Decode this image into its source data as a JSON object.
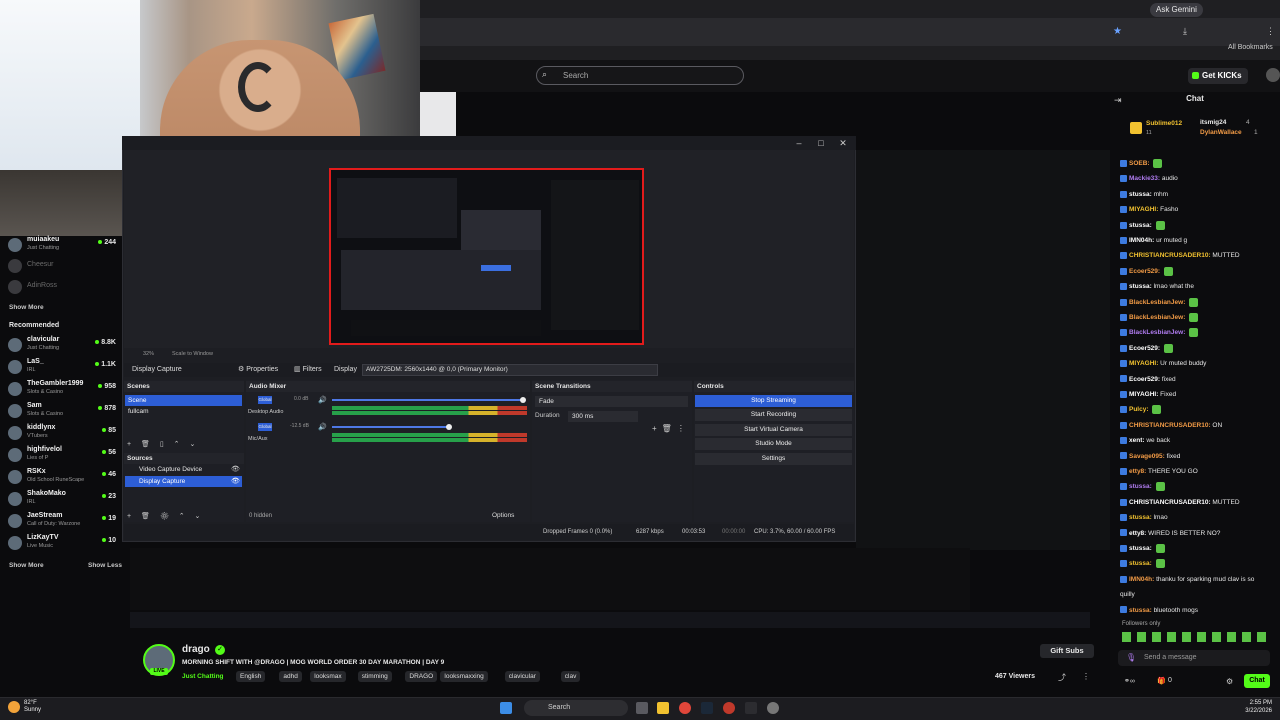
{
  "browser": {
    "ask_gemini": "Ask Gemini",
    "all_bookmarks": "All Bookmarks"
  },
  "kick_header": {
    "search_placeholder": "Search",
    "get_kicks": "Get KICKs"
  },
  "sidebar": {
    "top_items": [
      {
        "name": "muiaakeu",
        "category": "Just Chatting",
        "count": "244"
      },
      {
        "name": "Cheesur",
        "category": "",
        "count": ""
      },
      {
        "name": "AdinRoss",
        "category": "",
        "count": ""
      }
    ],
    "show_more_1": "Show More",
    "recommended_label": "Recommended",
    "recommended": [
      {
        "name": "clavicular",
        "category": "Just Chatting",
        "count": "8.8K"
      },
      {
        "name": "LaS_",
        "category": "IRL",
        "count": "1.1K"
      },
      {
        "name": "TheGambler1999",
        "category": "Slots & Casino",
        "count": "958"
      },
      {
        "name": "Sam",
        "category": "Slots & Casino",
        "count": "878"
      },
      {
        "name": "kiddlynx",
        "category": "VTubers",
        "count": "85"
      },
      {
        "name": "highfivelol",
        "category": "Lies of P",
        "count": "56"
      },
      {
        "name": "RSKx",
        "category": "Old School RuneScape",
        "count": "46"
      },
      {
        "name": "ShakoMako",
        "category": "IRL",
        "count": "23"
      },
      {
        "name": "JaeStream",
        "category": "Call of Duty: Warzone",
        "count": "19"
      },
      {
        "name": "LizKayTV",
        "category": "Live Music",
        "count": "10"
      }
    ],
    "show_more_2": "Show More",
    "show_less": "Show Less"
  },
  "obs": {
    "zoom": "32%",
    "scale_label": "Scale to Window",
    "source_name": "Display Capture",
    "properties": "Properties",
    "filters": "Filters",
    "display_label": "Display",
    "display_value": "AW2725DM: 2560x1440 @ 0,0 (Primary Monitor)",
    "scenes_header": "Scenes",
    "scenes": [
      "Scene",
      "fullcam"
    ],
    "sources_header": "Sources",
    "sources": [
      "Video Capture Device",
      "Display Capture"
    ],
    "mixer_header": "Audio Mixer",
    "channels": [
      {
        "badge": "Global",
        "name": "Desktop Audio",
        "db": "0.0 dB",
        "level": 0.98
      },
      {
        "badge": "Global",
        "name": "Mic/Aux",
        "db": "-12.5 dB",
        "level": 0.6
      }
    ],
    "hidden_label": "0 hidden",
    "options_label": "Options",
    "transitions_header": "Scene Transitions",
    "transition_value": "Fade",
    "duration_label": "Duration",
    "duration_value": "300 ms",
    "controls_header": "Controls",
    "controls": [
      "Stop Streaming",
      "Start Recording",
      "Start Virtual Camera",
      "Studio Mode",
      "Settings"
    ],
    "status": {
      "dropped": "Dropped Frames 0 (0.0%)",
      "kbps": "6287 kbps",
      "stream_time": "00:03:53",
      "rec_time": "00:00:00",
      "cpu": "CPU: 3.7%, 60.00 / 60.00 FPS"
    }
  },
  "chat": {
    "title": "Chat",
    "pinned": [
      {
        "user": "Sublime012",
        "count": "11"
      },
      {
        "user": "itsmig24",
        "count": "4"
      },
      {
        "user": "DylanWallace",
        "count": "1"
      }
    ],
    "messages": [
      {
        "user": "SOEB:",
        "text": ""
      },
      {
        "user": "Mackie33:",
        "text": "audio"
      },
      {
        "user": "stussa:",
        "text": "mhm"
      },
      {
        "user": "MIYAGHI:",
        "text": "Fasho"
      },
      {
        "user": "stussa:",
        "text": ""
      },
      {
        "user": "IMN04h:",
        "text": "ur muted g"
      },
      {
        "user": "CHRISTIANCRUSADER10:",
        "text": "MUTTED"
      },
      {
        "user": "Ecoer529:",
        "text": ""
      },
      {
        "user": "stussa:",
        "text": "lmao what the"
      },
      {
        "user": "BlackLesbianJew:",
        "text": ""
      },
      {
        "user": "BlackLesbianJew:",
        "text": ""
      },
      {
        "user": "BlackLesbianJew:",
        "text": ""
      },
      {
        "user": "Ecoer529:",
        "text": ""
      },
      {
        "user": "MIYAGHI:",
        "text": "Ur muted buddy"
      },
      {
        "user": "Ecoer529:",
        "text": "fixed"
      },
      {
        "user": "MIYAGHI:",
        "text": "Fixed"
      },
      {
        "user": "Pulcy:",
        "text": ""
      },
      {
        "user": "CHRISTIANCRUSADER10:",
        "text": "ON"
      },
      {
        "user": "xent:",
        "text": "we back"
      },
      {
        "user": "Savage095:",
        "text": "fixed"
      },
      {
        "user": "etty8:",
        "text": "THERE YOU GO"
      },
      {
        "user": "stussa:",
        "text": ""
      },
      {
        "user": "CHRISTIANCRUSADER10:",
        "text": "MUTTED"
      },
      {
        "user": "stussa:",
        "text": "lmao"
      },
      {
        "user": "etty8:",
        "text": "WIRED IS BETTER NO?"
      },
      {
        "user": "stussa:",
        "text": ""
      },
      {
        "user": "stussa:",
        "text": ""
      },
      {
        "user": "IMN04h:",
        "text": "thanku for sparking mud clav is so"
      },
      {
        "user": "",
        "text": "quilly"
      },
      {
        "user": "stussa:",
        "text": "bluetooth mogs"
      }
    ],
    "followers_only": "Followers only",
    "input_placeholder": "Send a message",
    "chat_button": "Chat",
    "count_a": "0",
    "count_b": "0"
  },
  "stream": {
    "streamer": "drago",
    "title": "MORNING SHIFT WITH @DRAGO | MOG WORLD ORDER 30 DAY MARATHON | DAY 9",
    "category": "Just Chatting",
    "tags": [
      "English",
      "adhd",
      "looksmax",
      "stimming",
      "DRAGO",
      "looksmaxxing",
      "clavicular",
      "clav"
    ],
    "gift_subs": "Gift Subs",
    "viewers": "467 Viewers"
  },
  "taskbar": {
    "weather_temp": "82°F",
    "weather_desc": "Sunny",
    "search": "Search",
    "time": "2:55 PM",
    "date": "3/22/2026"
  }
}
